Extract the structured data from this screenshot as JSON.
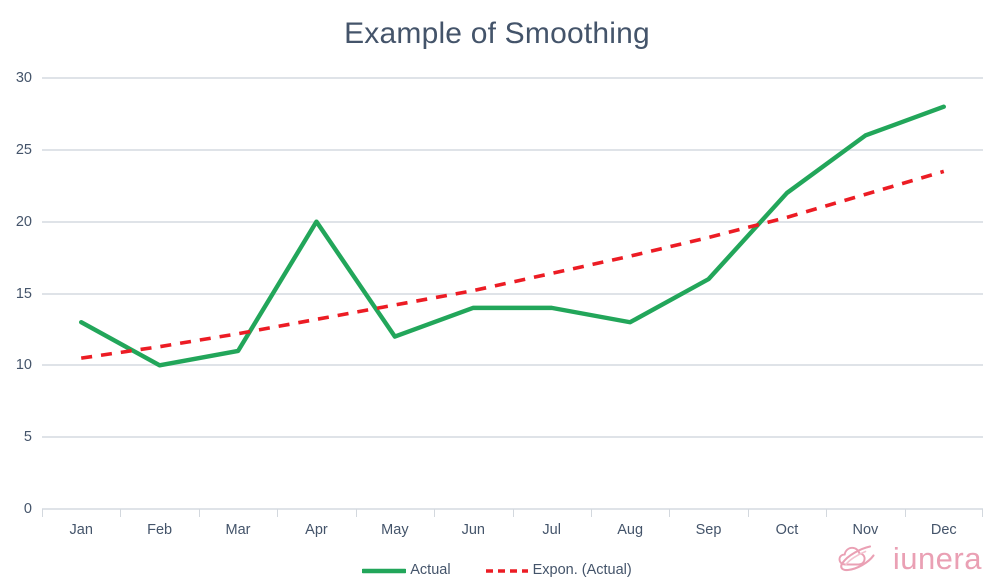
{
  "chart_data": {
    "type": "line",
    "title": "Example of Smoothing",
    "xlabel": "",
    "ylabel": "",
    "categories": [
      "Jan",
      "Feb",
      "Mar",
      "Apr",
      "May",
      "Jun",
      "Jul",
      "Aug",
      "Sep",
      "Oct",
      "Nov",
      "Dec"
    ],
    "yticks": [
      0,
      5,
      10,
      15,
      20,
      25,
      30
    ],
    "ylim": [
      0,
      30
    ],
    "grid": true,
    "legend_position": "bottom",
    "series": [
      {
        "name": "Actual",
        "style": "solid",
        "color": "#22a65a",
        "values": [
          13,
          10,
          11,
          20,
          12,
          14,
          14,
          13,
          16,
          22,
          26,
          28
        ]
      },
      {
        "name": "Expon. (Actual)",
        "style": "dashed",
        "color": "#ec1c24",
        "values": [
          10.5,
          11.3,
          12.2,
          13.2,
          14.2,
          15.2,
          16.4,
          17.6,
          18.9,
          20.3,
          21.9,
          23.5
        ]
      }
    ]
  },
  "title": {
    "text": "Example of Smoothing",
    "color": "#44546a"
  },
  "legend": {
    "items": [
      {
        "label": "Actual",
        "color": "#22a65a",
        "style": "solid"
      },
      {
        "label": "Expon. (Actual)",
        "color": "#ec1c24",
        "style": "dashed"
      }
    ]
  },
  "branding": {
    "name": "iunera",
    "color": "#eaa0b4",
    "icon": "cloud-orbit-icon"
  },
  "axes": {
    "y_labels": [
      "30",
      "25",
      "20",
      "15",
      "10",
      "5",
      "0"
    ],
    "x_labels": [
      "Jan",
      "Feb",
      "Mar",
      "Apr",
      "May",
      "Jun",
      "Jul",
      "Aug",
      "Sep",
      "Oct",
      "Nov",
      "Dec"
    ],
    "gridline_color": "#dfe3e8",
    "label_color": "#44546a"
  }
}
